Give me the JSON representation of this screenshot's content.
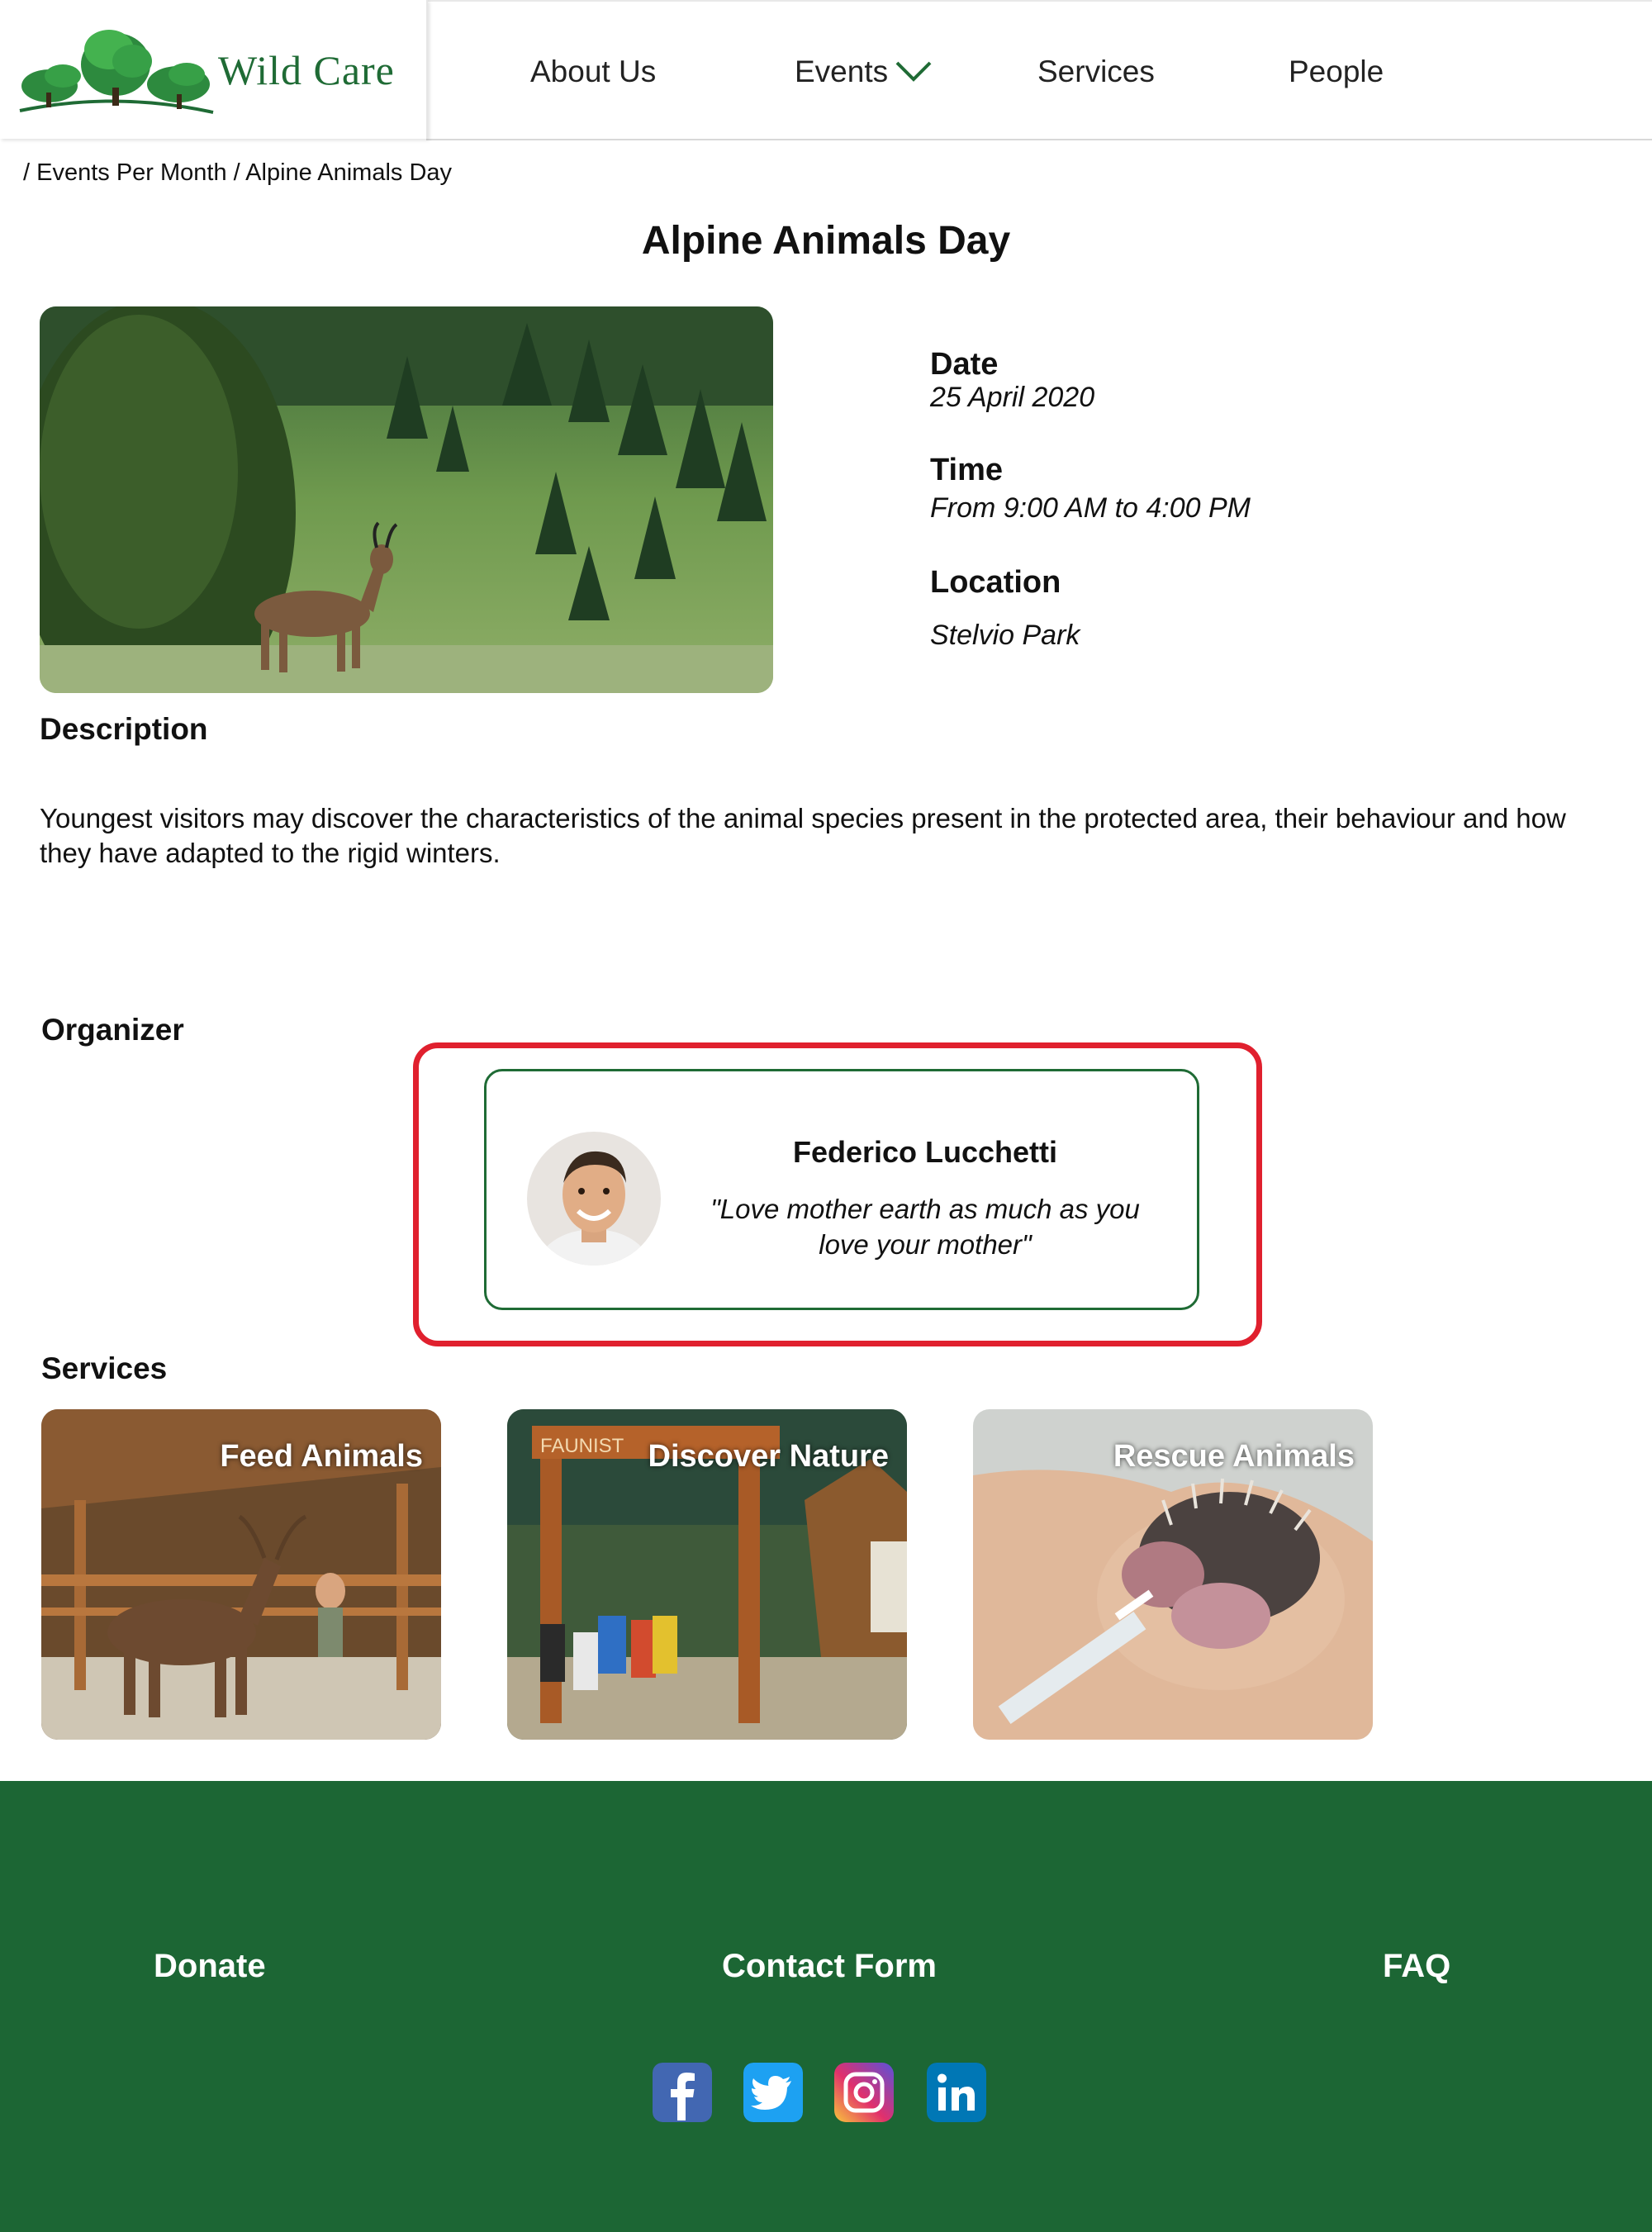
{
  "header": {
    "logo_text": "Wild Care",
    "nav": [
      "About Us",
      "Events",
      "Services",
      "People"
    ]
  },
  "breadcrumb": "/ Events Per Month / Alpine Animals Day",
  "page_title": "Alpine Animals Day",
  "event": {
    "date_label": "Date",
    "date_value": "25 April 2020",
    "time_label": "Time",
    "time_value": "From 9:00 AM to 4:00 PM",
    "location_label": "Location",
    "location_value": "Stelvio Park"
  },
  "description": {
    "heading": "Description",
    "text": "Youngest visitors may discover the characteristics of the animal species present in the protected area, their behaviour and how they have adapted to the rigid winters."
  },
  "organizer": {
    "heading": "Organizer",
    "name": "Federico Lucchetti",
    "quote": "\"Love mother earth as much as you love your mother\""
  },
  "services": {
    "heading": "Services",
    "items": [
      {
        "label": "Feed Animals"
      },
      {
        "label": "Discover Nature"
      },
      {
        "label": "Rescue Animals"
      }
    ]
  },
  "footer": {
    "links": [
      "Donate",
      "Contact Form",
      "FAQ"
    ],
    "social_icons": [
      "facebook-icon",
      "twitter-icon",
      "instagram-icon",
      "linkedin-icon"
    ]
  },
  "colors": {
    "brand_green": "#1c6634",
    "highlight_red": "#e0202e"
  }
}
